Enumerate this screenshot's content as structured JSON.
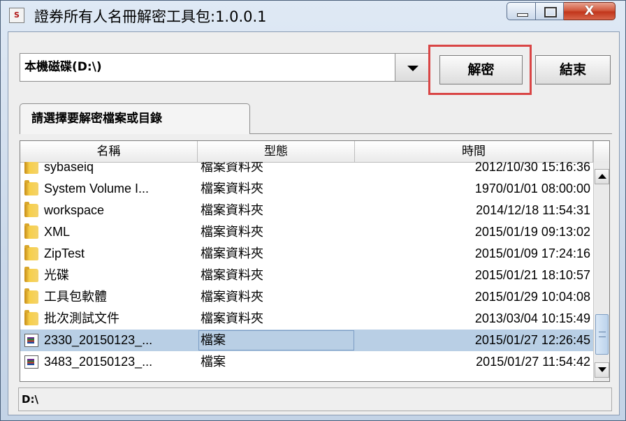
{
  "window": {
    "title": "證券所有人名冊解密工具包:1.0.0.1",
    "icon_text": "S",
    "close_glyph": "X"
  },
  "toolbar": {
    "drive_selected": "本機磁碟(D:\\)",
    "decrypt_label": "解密",
    "quit_label": "結束"
  },
  "tab": {
    "label": "請選擇要解密檔案或目錄"
  },
  "table": {
    "columns": [
      "名稱",
      "型態",
      "時間"
    ],
    "rows": [
      {
        "name": "sybaseiq",
        "type": "檔案資料夾",
        "time": "2012/10/30 15:16:36",
        "icon": "folder-icon"
      },
      {
        "name": "System Volume I...",
        "type": "檔案資料夾",
        "time": "1970/01/01 08:00:00",
        "icon": "folder-icon"
      },
      {
        "name": "workspace",
        "type": "檔案資料夾",
        "time": "2014/12/18 11:54:31",
        "icon": "folder-icon"
      },
      {
        "name": "XML",
        "type": "檔案資料夾",
        "time": "2015/01/19 09:13:02",
        "icon": "folder-icon"
      },
      {
        "name": "ZipTest",
        "type": "檔案資料夾",
        "time": "2015/01/09 17:24:16",
        "icon": "folder-icon"
      },
      {
        "name": "光碟",
        "type": "檔案資料夾",
        "time": "2015/01/21 18:10:57",
        "icon": "folder-icon"
      },
      {
        "name": "工具包軟體",
        "type": "檔案資料夾",
        "time": "2015/01/29 10:04:08",
        "icon": "folder-icon"
      },
      {
        "name": "批次測試文件",
        "type": "檔案資料夾",
        "time": "2013/03/04 10:15:49",
        "icon": "folder-icon"
      },
      {
        "name": "2330_20150123_...",
        "type": "檔案",
        "time": "2015/01/27 12:26:45",
        "icon": "archive-file-icon",
        "selected": true
      },
      {
        "name": "3483_20150123_...",
        "type": "檔案",
        "time": "2015/01/27 11:54:42",
        "icon": "archive-file-icon"
      }
    ]
  },
  "status": {
    "path": "D:\\"
  },
  "colors": {
    "selected_row": "#b9cfe5",
    "highlight_border": "#d94545"
  }
}
